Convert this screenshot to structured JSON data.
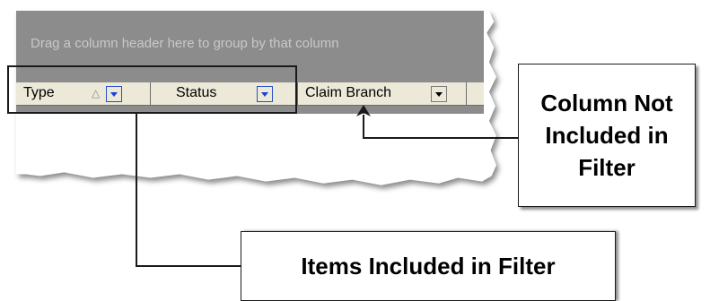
{
  "grid": {
    "group_panel_text": "Drag a column header here to group by that column",
    "columns": [
      {
        "label": "Type",
        "sort_icon": "sort-ascending-icon",
        "sort_symbol": "△",
        "filter_active": true
      },
      {
        "label": "Status",
        "filter_active": true
      },
      {
        "label": "Claim Branch",
        "filter_active": false
      }
    ]
  },
  "callouts": {
    "not_included": [
      "Column Not",
      "Included in",
      "Filter"
    ],
    "included": "Items Included in Filter"
  },
  "colors": {
    "group_panel": "#8c8c8c",
    "header_cell": "#ece9d8",
    "active_filter_arrow": "#1a40e0",
    "inactive_filter_arrow": "#000000",
    "callout_border": "#1a1a1a"
  },
  "icons": {
    "dropdown": "chevron-down-icon",
    "arrow": "arrow-up-icon"
  }
}
